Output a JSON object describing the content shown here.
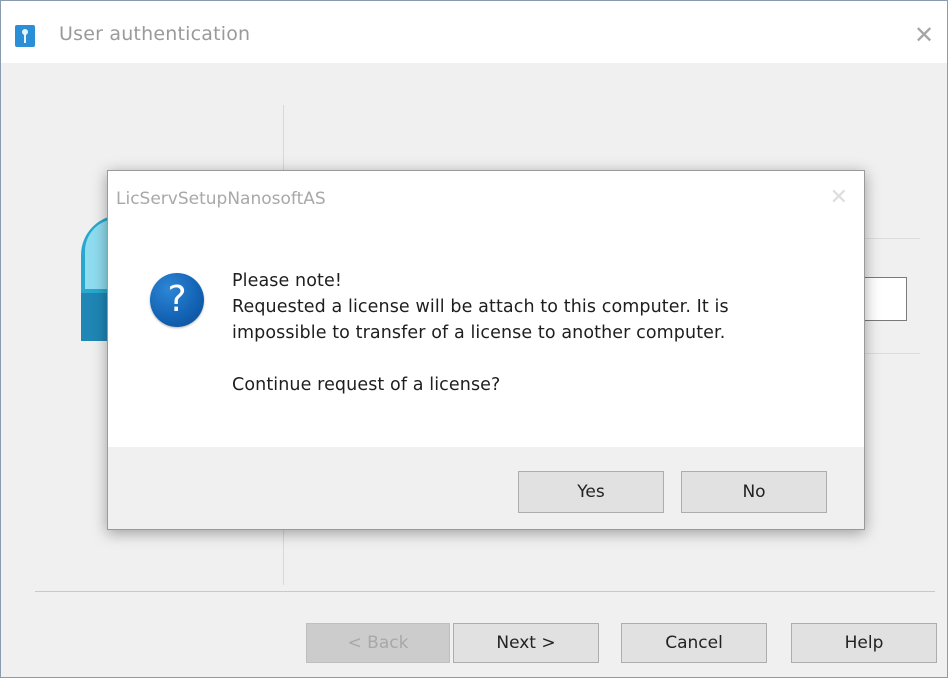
{
  "main_window": {
    "title": "User authentication",
    "close_glyph": "✕",
    "buttons": {
      "back": "< Back",
      "next": "Next >",
      "cancel": "Cancel",
      "help": "Help"
    }
  },
  "message_box": {
    "title": "LicServSetupNanosoftAS",
    "close_glyph": "✕",
    "icon": "question-icon",
    "icon_glyph": "?",
    "lines": [
      "Please note!",
      "Requested a license will be attach to this computer. It is",
      "impossible to transfer of a license to another computer.",
      "Continue request of a license?"
    ],
    "buttons": {
      "yes": "Yes",
      "no": "No"
    }
  },
  "colors": {
    "accent": "#1261b2",
    "logo": "#28a8cf"
  }
}
